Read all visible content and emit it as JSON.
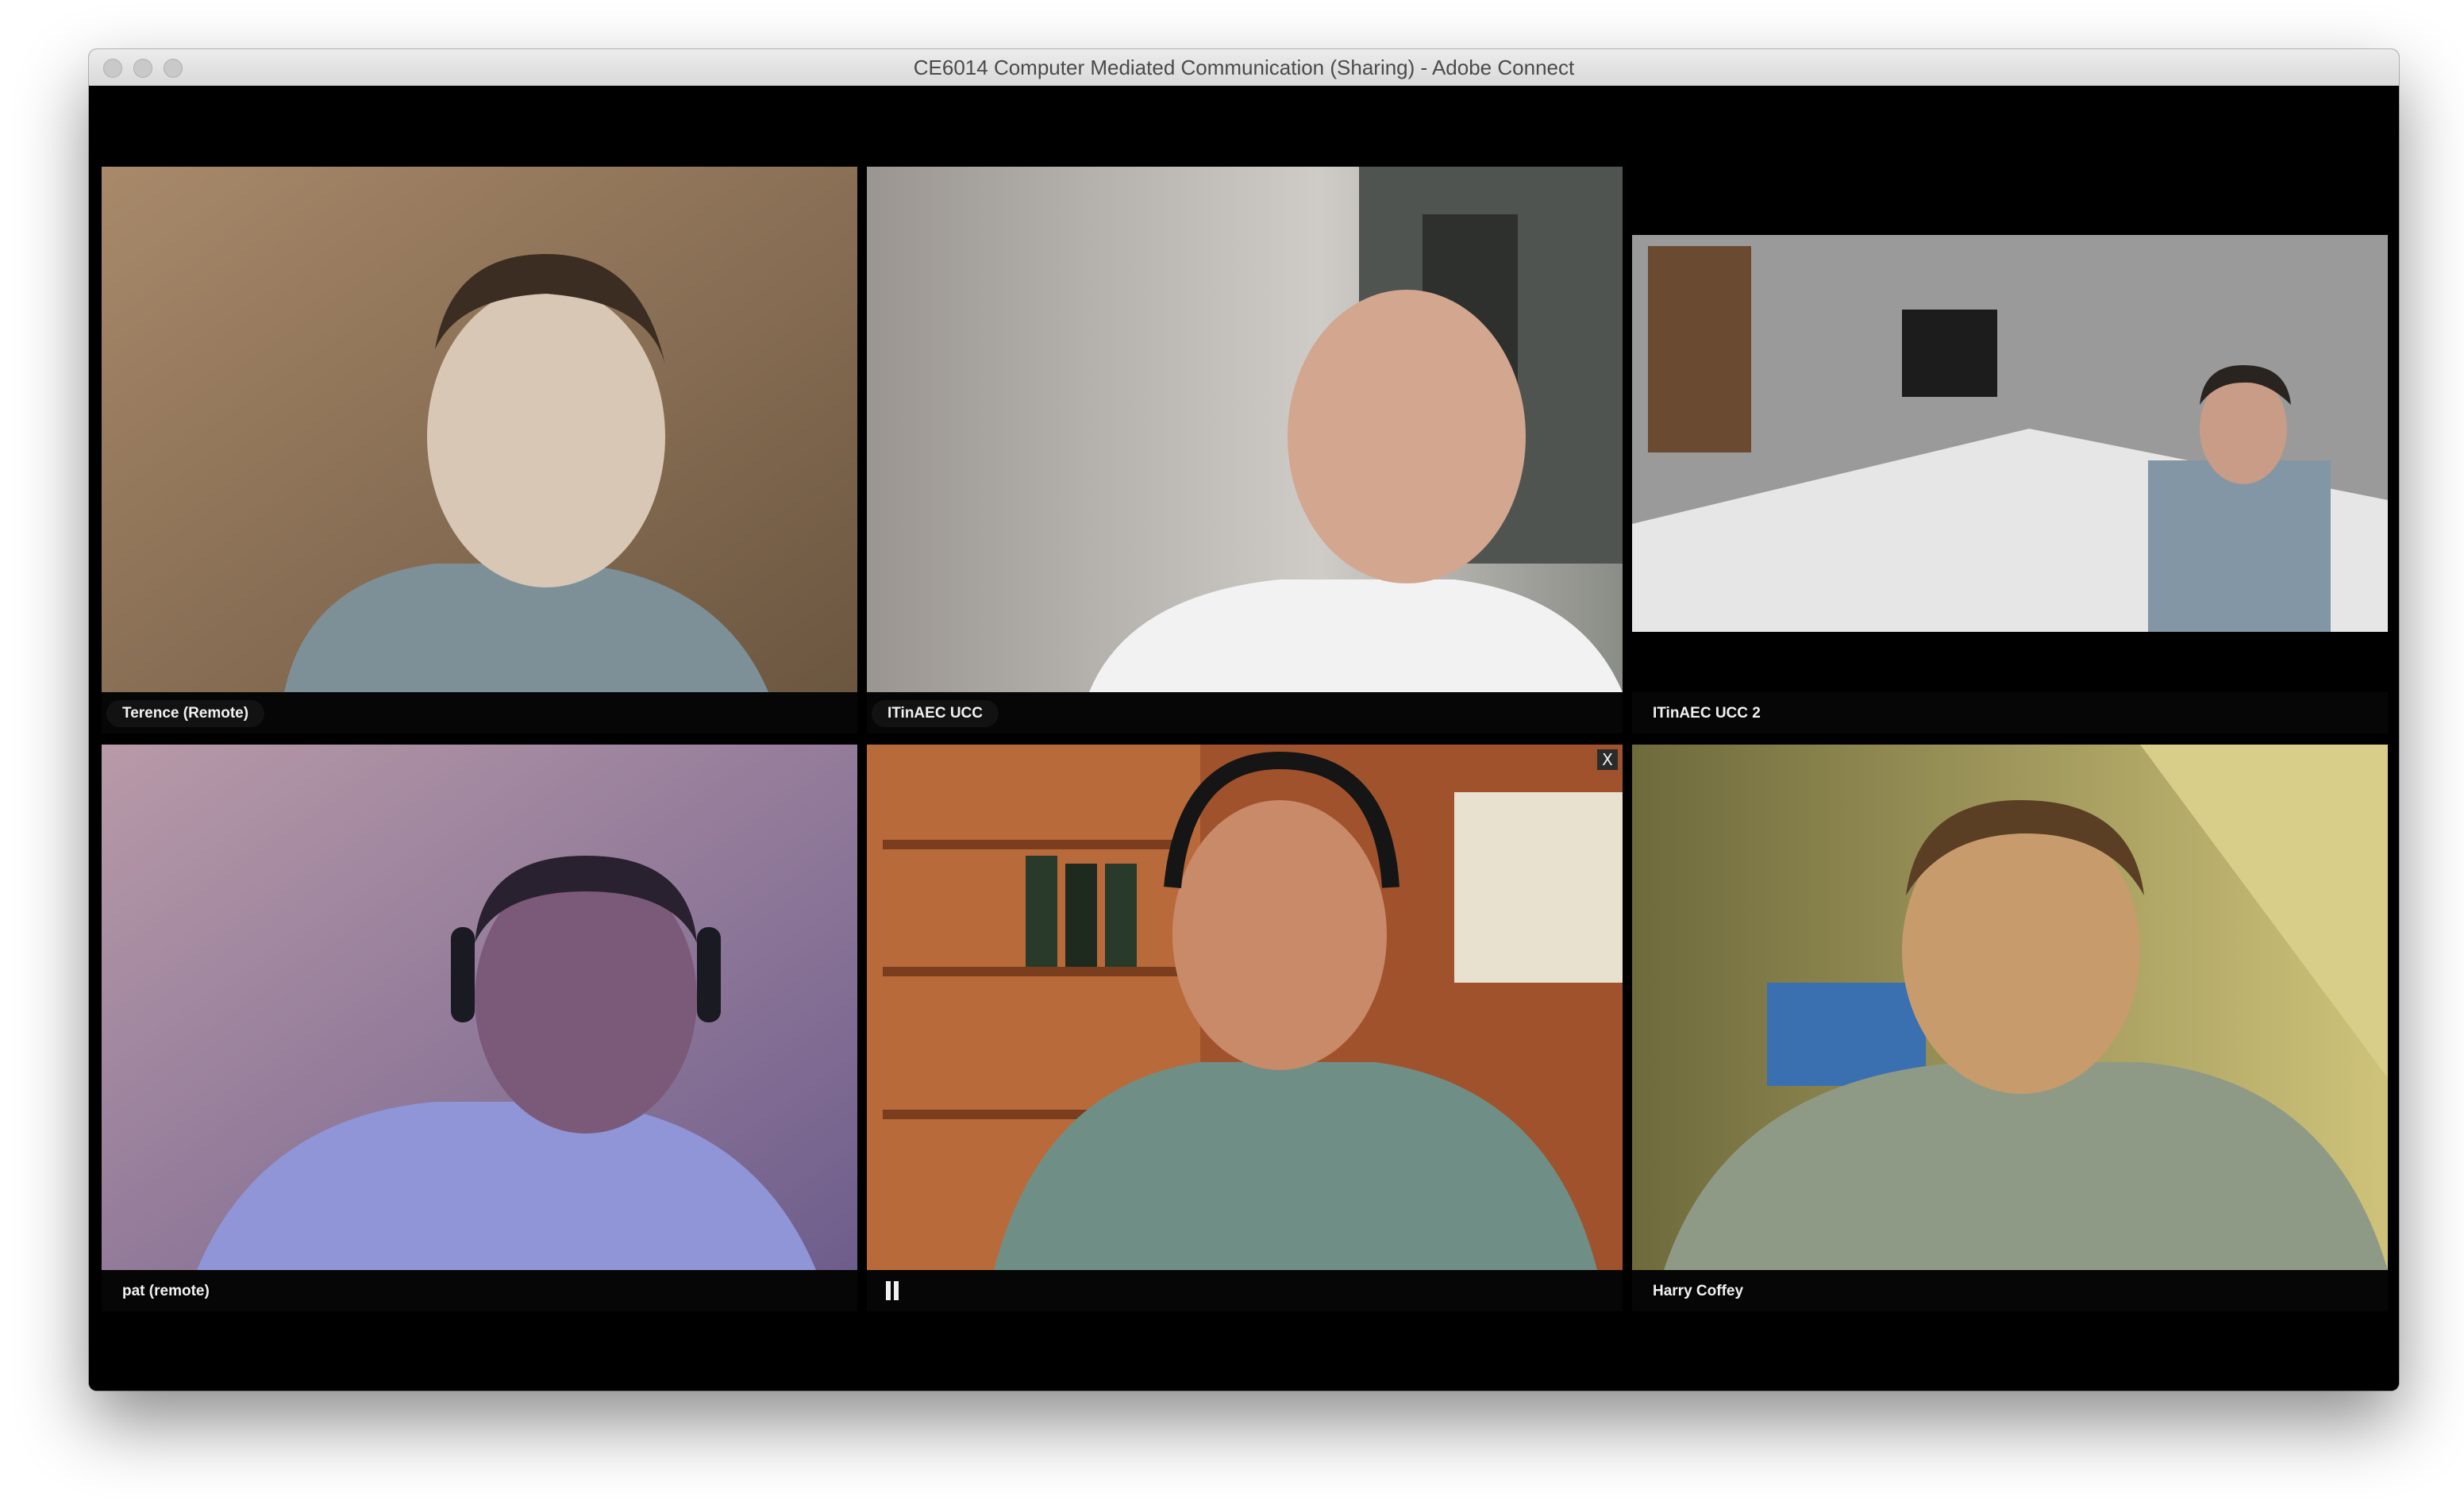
{
  "window": {
    "title": "CE6014 Computer Mediated Communication (Sharing) - Adobe Connect"
  },
  "participants": [
    {
      "name": "Terence (Remote)",
      "label_style": "pill"
    },
    {
      "name": "ITinAEC UCC",
      "label_style": "pill"
    },
    {
      "name": "ITinAEC UCC 2",
      "label_style": "plain"
    },
    {
      "name": "pat (remote)",
      "label_style": "plain"
    },
    {
      "name": "",
      "label_style": "pause",
      "controls": {
        "pause_icon": "pause-icon",
        "close_label": "X"
      }
    },
    {
      "name": "Harry Coffey",
      "label_style": "plain"
    }
  ],
  "colors": {
    "window_bg": "#000000",
    "titlebar": "#e4e4e4",
    "label_pill": "#141414",
    "label_text": "#f2f2f2"
  }
}
